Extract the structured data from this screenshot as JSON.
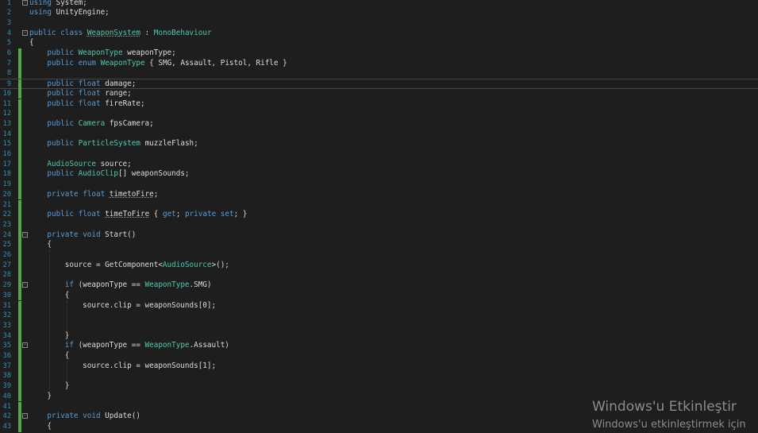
{
  "editor": {
    "lines": [
      {
        "n": "1",
        "segments": [
          {
            "t": "using",
            "c": "kw"
          },
          {
            "t": " System;"
          }
        ]
      },
      {
        "n": "2",
        "segments": [
          {
            "t": "using",
            "c": "kw"
          },
          {
            "t": " UnityEngine;"
          }
        ]
      },
      {
        "n": "3",
        "segments": []
      },
      {
        "n": "4",
        "segments": [
          {
            "t": "public",
            "c": "kw"
          },
          {
            "t": " "
          },
          {
            "t": "class",
            "c": "kw"
          },
          {
            "t": " "
          },
          {
            "t": "WeaponSystem",
            "c": "ty sq"
          },
          {
            "t": " : "
          },
          {
            "t": "MonoBehaviour",
            "c": "ty"
          }
        ]
      },
      {
        "n": "5",
        "segments": [
          {
            "t": "{"
          }
        ]
      },
      {
        "n": "6",
        "segments": [
          {
            "t": "    "
          },
          {
            "t": "public",
            "c": "kw"
          },
          {
            "t": " "
          },
          {
            "t": "WeaponType",
            "c": "ty"
          },
          {
            "t": " weaponType;"
          }
        ]
      },
      {
        "n": "7",
        "segments": [
          {
            "t": "    "
          },
          {
            "t": "public",
            "c": "kw"
          },
          {
            "t": " "
          },
          {
            "t": "enum",
            "c": "kw"
          },
          {
            "t": " "
          },
          {
            "t": "WeaponType",
            "c": "ty"
          },
          {
            "t": " { SMG, Assault, Pistol, Rifle }"
          }
        ]
      },
      {
        "n": "8",
        "segments": []
      },
      {
        "n": "9",
        "segments": [
          {
            "t": "    "
          },
          {
            "t": "public",
            "c": "kw"
          },
          {
            "t": " "
          },
          {
            "t": "float",
            "c": "kw"
          },
          {
            "t": " damage;"
          }
        ]
      },
      {
        "n": "10",
        "segments": [
          {
            "t": "    "
          },
          {
            "t": "public",
            "c": "kw"
          },
          {
            "t": " "
          },
          {
            "t": "float",
            "c": "kw"
          },
          {
            "t": " range;"
          }
        ]
      },
      {
        "n": "11",
        "segments": [
          {
            "t": "    "
          },
          {
            "t": "public",
            "c": "kw"
          },
          {
            "t": " "
          },
          {
            "t": "float",
            "c": "kw"
          },
          {
            "t": " fireRate;"
          }
        ]
      },
      {
        "n": "12",
        "segments": []
      },
      {
        "n": "13",
        "segments": [
          {
            "t": "    "
          },
          {
            "t": "public",
            "c": "kw"
          },
          {
            "t": " "
          },
          {
            "t": "Camera",
            "c": "ty"
          },
          {
            "t": " fpsCamera;"
          }
        ]
      },
      {
        "n": "14",
        "segments": []
      },
      {
        "n": "15",
        "segments": [
          {
            "t": "    "
          },
          {
            "t": "public",
            "c": "kw"
          },
          {
            "t": " "
          },
          {
            "t": "ParticleSystem",
            "c": "ty"
          },
          {
            "t": " muzzleFlash;"
          }
        ]
      },
      {
        "n": "16",
        "segments": []
      },
      {
        "n": "17",
        "segments": [
          {
            "t": "    "
          },
          {
            "t": "AudioSource",
            "c": "ty"
          },
          {
            "t": " source;"
          }
        ]
      },
      {
        "n": "18",
        "segments": [
          {
            "t": "    "
          },
          {
            "t": "public",
            "c": "kw"
          },
          {
            "t": " "
          },
          {
            "t": "AudioClip",
            "c": "ty"
          },
          {
            "t": "[] weaponSounds;"
          }
        ]
      },
      {
        "n": "19",
        "segments": []
      },
      {
        "n": "20",
        "segments": [
          {
            "t": "    "
          },
          {
            "t": "private",
            "c": "kw"
          },
          {
            "t": " "
          },
          {
            "t": "float",
            "c": "kw"
          },
          {
            "t": " "
          },
          {
            "t": "timetoFire",
            "c": "sq"
          },
          {
            "t": ";"
          }
        ]
      },
      {
        "n": "21",
        "segments": []
      },
      {
        "n": "22",
        "segments": [
          {
            "t": "    "
          },
          {
            "t": "public",
            "c": "kw"
          },
          {
            "t": " "
          },
          {
            "t": "float",
            "c": "kw"
          },
          {
            "t": " "
          },
          {
            "t": "timeToFire",
            "c": "sq"
          },
          {
            "t": " { "
          },
          {
            "t": "get",
            "c": "kw"
          },
          {
            "t": "; "
          },
          {
            "t": "private",
            "c": "kw"
          },
          {
            "t": " "
          },
          {
            "t": "set",
            "c": "kw"
          },
          {
            "t": "; }"
          }
        ]
      },
      {
        "n": "23",
        "segments": []
      },
      {
        "n": "24",
        "segments": [
          {
            "t": "    "
          },
          {
            "t": "private",
            "c": "kw"
          },
          {
            "t": " "
          },
          {
            "t": "void",
            "c": "kw"
          },
          {
            "t": " Start()"
          }
        ]
      },
      {
        "n": "25",
        "segments": [
          {
            "t": "    {"
          }
        ]
      },
      {
        "n": "26",
        "segments": []
      },
      {
        "n": "27",
        "segments": [
          {
            "t": "        source = GetComponent<"
          },
          {
            "t": "AudioSource",
            "c": "ty"
          },
          {
            "t": ">();"
          }
        ]
      },
      {
        "n": "28",
        "segments": []
      },
      {
        "n": "29",
        "segments": [
          {
            "t": "        "
          },
          {
            "t": "if",
            "c": "kw"
          },
          {
            "t": " (weaponType == "
          },
          {
            "t": "WeaponType",
            "c": "ty"
          },
          {
            "t": ".SMG)"
          }
        ]
      },
      {
        "n": "30",
        "segments": [
          {
            "t": "        {"
          }
        ]
      },
      {
        "n": "31",
        "segments": [
          {
            "t": "            source.clip = weaponSounds[0];"
          }
        ]
      },
      {
        "n": "32",
        "segments": []
      },
      {
        "n": "33",
        "segments": []
      },
      {
        "n": "34",
        "segments": [
          {
            "t": "        }"
          }
        ]
      },
      {
        "n": "35",
        "segments": [
          {
            "t": "        "
          },
          {
            "t": "if",
            "c": "kw"
          },
          {
            "t": " (weaponType == "
          },
          {
            "t": "WeaponType",
            "c": "ty"
          },
          {
            "t": ".Assault)"
          }
        ]
      },
      {
        "n": "36",
        "segments": [
          {
            "t": "        {"
          }
        ]
      },
      {
        "n": "37",
        "segments": [
          {
            "t": "            source.clip = weaponSounds[1];"
          }
        ]
      },
      {
        "n": "38",
        "segments": []
      },
      {
        "n": "39",
        "segments": [
          {
            "t": "        }"
          }
        ]
      },
      {
        "n": "40",
        "segments": [
          {
            "t": "    }"
          }
        ]
      },
      {
        "n": "41",
        "segments": []
      },
      {
        "n": "42",
        "segments": [
          {
            "t": "    "
          },
          {
            "t": "private",
            "c": "kw"
          },
          {
            "t": " "
          },
          {
            "t": "void",
            "c": "kw"
          },
          {
            "t": " Update()"
          }
        ]
      },
      {
        "n": "43",
        "segments": [
          {
            "t": "    {"
          }
        ]
      }
    ]
  },
  "watermark": {
    "line1": "Windows'u Etkinleştir",
    "line2": "Windows'u etkinleştirmek için"
  },
  "colors": {
    "background": "#1e1e1e",
    "keyword": "#569cd6",
    "type": "#4ec9b0",
    "text": "#dcdcdc",
    "line_number": "#2b91af",
    "change_bar": "#57a64a"
  }
}
